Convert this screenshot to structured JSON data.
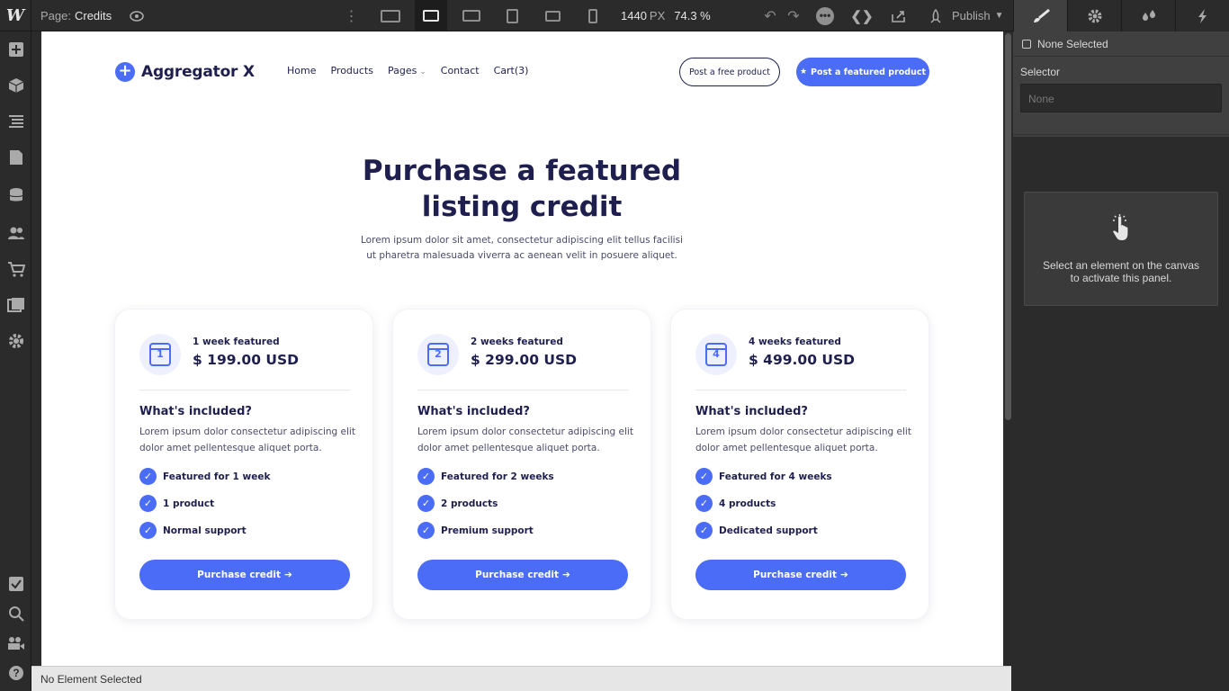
{
  "topbar": {
    "logo": "W",
    "page_label": "Page:",
    "page_name": "Credits",
    "width_value": "1440",
    "width_unit": "PX",
    "zoom": "74.3 %",
    "publish": "Publish"
  },
  "right_panel": {
    "none_selected": "None Selected",
    "selector_label": "Selector",
    "selector_placeholder": "None",
    "hint": "Select an element on the canvas to activate this panel."
  },
  "status": "No Element Selected",
  "site": {
    "logo": "Aggregator X",
    "nav": [
      "Home",
      "Products",
      "Pages",
      "Contact",
      "Cart(3)"
    ],
    "btn_free": "Post a free product",
    "btn_featured": "Post a featured product",
    "hero_title": "Purchase a featured listing credit",
    "hero_sub": "Lorem ipsum dolor sit amet, consectetur adipiscing elit tellus facilisi ut pharetra malesuada viverra ac aenean velit in posuere aliquet.",
    "cards": [
      {
        "num": "1",
        "duration": "1 week featured",
        "price": "$ 199.00 USD",
        "included": "What's included?",
        "desc": "Lorem ipsum dolor consectetur adipiscing elit dolor amet pellentesque aliquet porta.",
        "features": [
          "Featured for 1 week",
          "1 product",
          "Normal support"
        ],
        "cta": "Purchase credit"
      },
      {
        "num": "2",
        "duration": "2 weeks featured",
        "price": "$ 299.00 USD",
        "included": "What's included?",
        "desc": "Lorem ipsum dolor consectetur adipiscing elit dolor amet pellentesque aliquet porta.",
        "features": [
          "Featured for 2 weeks",
          "2 products",
          "Premium support"
        ],
        "cta": "Purchase credit"
      },
      {
        "num": "4",
        "duration": "4 weeks featured",
        "price": "$ 499.00 USD",
        "included": "What's included?",
        "desc": "Lorem ipsum dolor consectetur adipiscing elit dolor amet pellentesque aliquet porta.",
        "features": [
          "Featured for 4 weeks",
          "4 products",
          "Dedicated support"
        ],
        "cta": "Purchase credit"
      }
    ]
  },
  "colors": {
    "accent": "#4a6cf7",
    "navy": "#1f1f4f",
    "editor_bg": "#2b2b2b"
  }
}
